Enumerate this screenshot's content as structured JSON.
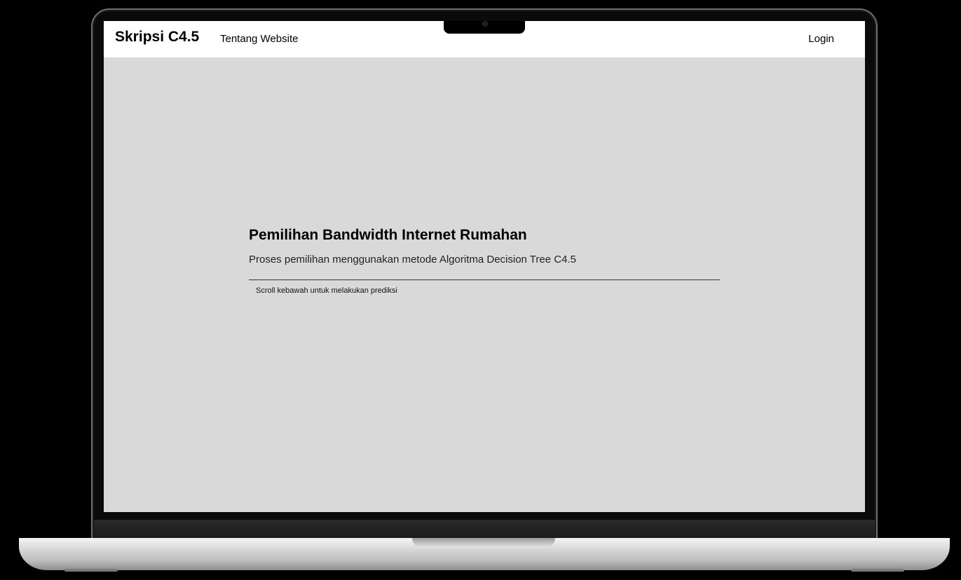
{
  "navbar": {
    "brand": "Skripsi C4.5",
    "about_link": "Tentang Website",
    "login_link": "Login"
  },
  "hero": {
    "title": "Pemilihan Bandwidth Internet Rumahan",
    "subtitle": "Proses pemilihan menggunakan metode Algoritma Decision Tree C4.5",
    "hint": "Scroll kebawah untuk melakukan prediksi"
  },
  "colors": {
    "navbar_bg": "#ffffff",
    "page_bg": "#d9d9d9",
    "text": "#000000"
  }
}
